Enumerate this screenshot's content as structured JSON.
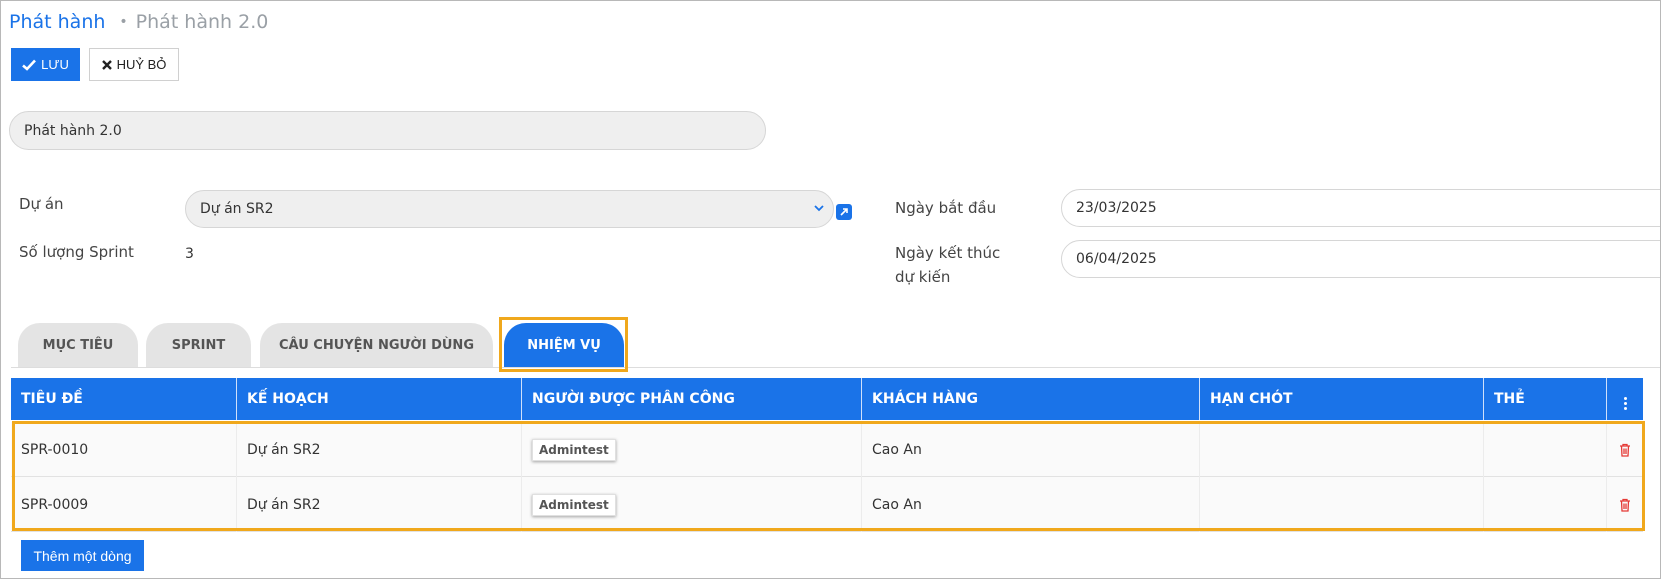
{
  "breadcrumb": {
    "root": "Phát hành",
    "separator": "•",
    "current": "Phát hành 2.0"
  },
  "toolbar": {
    "save_label": "LƯU",
    "cancel_label": "HUỶ BỎ"
  },
  "form": {
    "name_value": "Phát hành 2.0",
    "project_label": "Dự án",
    "project_value": "Dự án SR2",
    "sprint_count_label": "Số lượng Sprint",
    "sprint_count_value": "3",
    "start_date_label": "Ngày bắt đầu",
    "start_date_value": "23/03/2025",
    "end_date_label_line1": "Ngày kết thúc",
    "end_date_label_line2": "dự kiến",
    "end_date_value": "06/04/2025"
  },
  "tabs": [
    {
      "label": "MỤC TIÊU",
      "active": false
    },
    {
      "label": "SPRINT",
      "active": false
    },
    {
      "label": "CÂU CHUYỆN NGƯỜI DÙNG",
      "active": false
    },
    {
      "label": "NHIỆM VỤ",
      "active": true
    }
  ],
  "table": {
    "columns": [
      "TIÊU ĐỀ",
      "KẾ HOẠCH",
      "NGƯỜI ĐƯỢC PHÂN CÔNG",
      "KHÁCH HÀNG",
      "HẠN CHÓT",
      "THẺ"
    ],
    "rows": [
      {
        "title": "SPR-0010",
        "plan": "Dự án SR2",
        "assignee": "Admintest",
        "customer": "Cao An",
        "deadline": "",
        "tags": ""
      },
      {
        "title": "SPR-0009",
        "plan": "Dự án SR2",
        "assignee": "Admintest",
        "customer": "Cao An",
        "deadline": "",
        "tags": ""
      }
    ],
    "add_row_label": "Thêm một dòng"
  },
  "colors": {
    "accent": "#1a73e8",
    "highlight": "#f0a81c",
    "delete": "#e53935"
  },
  "icons": {
    "save": "check-icon",
    "cancel": "close-icon",
    "dropdown": "chevron-down-icon",
    "external": "external-link-icon",
    "delete": "trash-icon",
    "menu": "kebab-icon"
  }
}
